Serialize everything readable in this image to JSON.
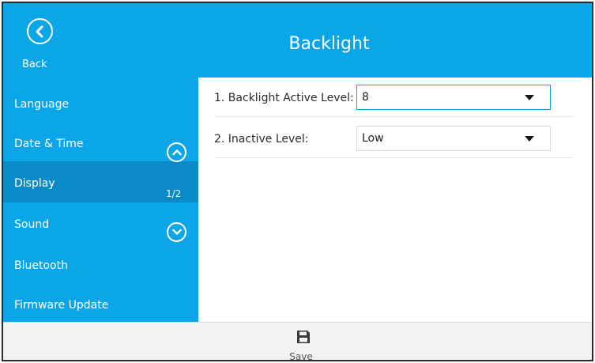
{
  "header": {
    "title": "Backlight",
    "back_label": "Back"
  },
  "sidebar": {
    "items": [
      {
        "label": "Language"
      },
      {
        "label": "Date & Time"
      },
      {
        "label": "Display",
        "active": true
      },
      {
        "label": "Sound"
      },
      {
        "label": "Bluetooth"
      },
      {
        "label": "Firmware Update"
      }
    ],
    "page_indicator": "1/2",
    "up_icon": "chevron-up-icon",
    "down_icon": "chevron-down-icon"
  },
  "settings": {
    "rows": [
      {
        "label": "1. Backlight Active Level:",
        "value": "8"
      },
      {
        "label": "2. Inactive Level:",
        "value": "Low"
      }
    ]
  },
  "footer": {
    "save_label": "Save",
    "save_icon": "floppy-disk-icon"
  },
  "colors": {
    "accent": "#0aa6e8",
    "active_item": "#0a8bc7"
  }
}
